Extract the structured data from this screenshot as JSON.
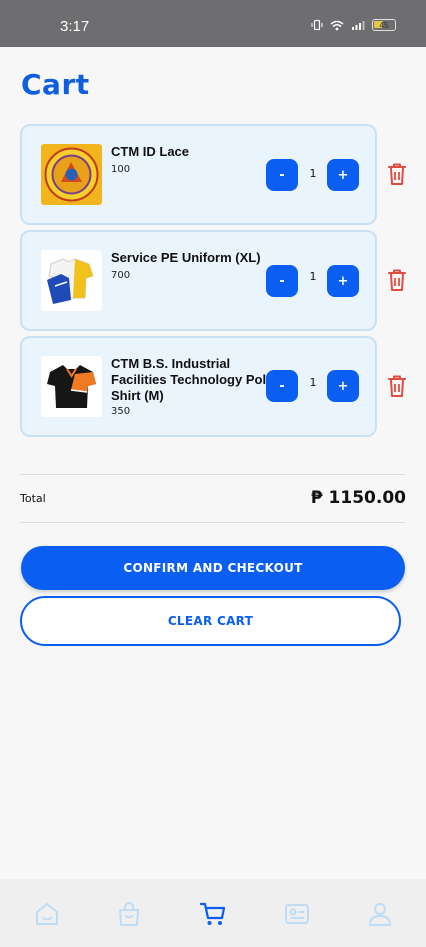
{
  "status_bar": {
    "time": "3:17",
    "battery": "45",
    "battery_level": 0.45
  },
  "page": {
    "title": "Cart"
  },
  "cart": {
    "items": [
      {
        "name": "CTM ID Lace",
        "price": "100",
        "quantity": "1",
        "minus_label": "-",
        "plus_label": "+"
      },
      {
        "name": "Service PE Uniform (XL)",
        "price": "700",
        "quantity": "1",
        "minus_label": "-",
        "plus_label": "+"
      },
      {
        "name": "CTM B.S. Industrial Facilities Technology Polo Shirt (M)",
        "price": "350",
        "quantity": "1",
        "minus_label": "-",
        "plus_label": "+"
      }
    ]
  },
  "summary": {
    "total_label": "Total",
    "total_value": "₱ 1150.00"
  },
  "actions": {
    "confirm_label": "CONFIRM AND CHECKOUT",
    "clear_label": "CLEAR CART"
  },
  "nav": {
    "active": "cart",
    "items": [
      "home-icon",
      "bag-icon",
      "cart-icon",
      "orders-icon",
      "profile-icon"
    ]
  },
  "colors": {
    "accent": "#0a5ef2",
    "title": "#0e5fe0",
    "delete": "#e24b40",
    "card_bg": "#e9f4fd",
    "nav_inactive": "#bfdcf7"
  }
}
